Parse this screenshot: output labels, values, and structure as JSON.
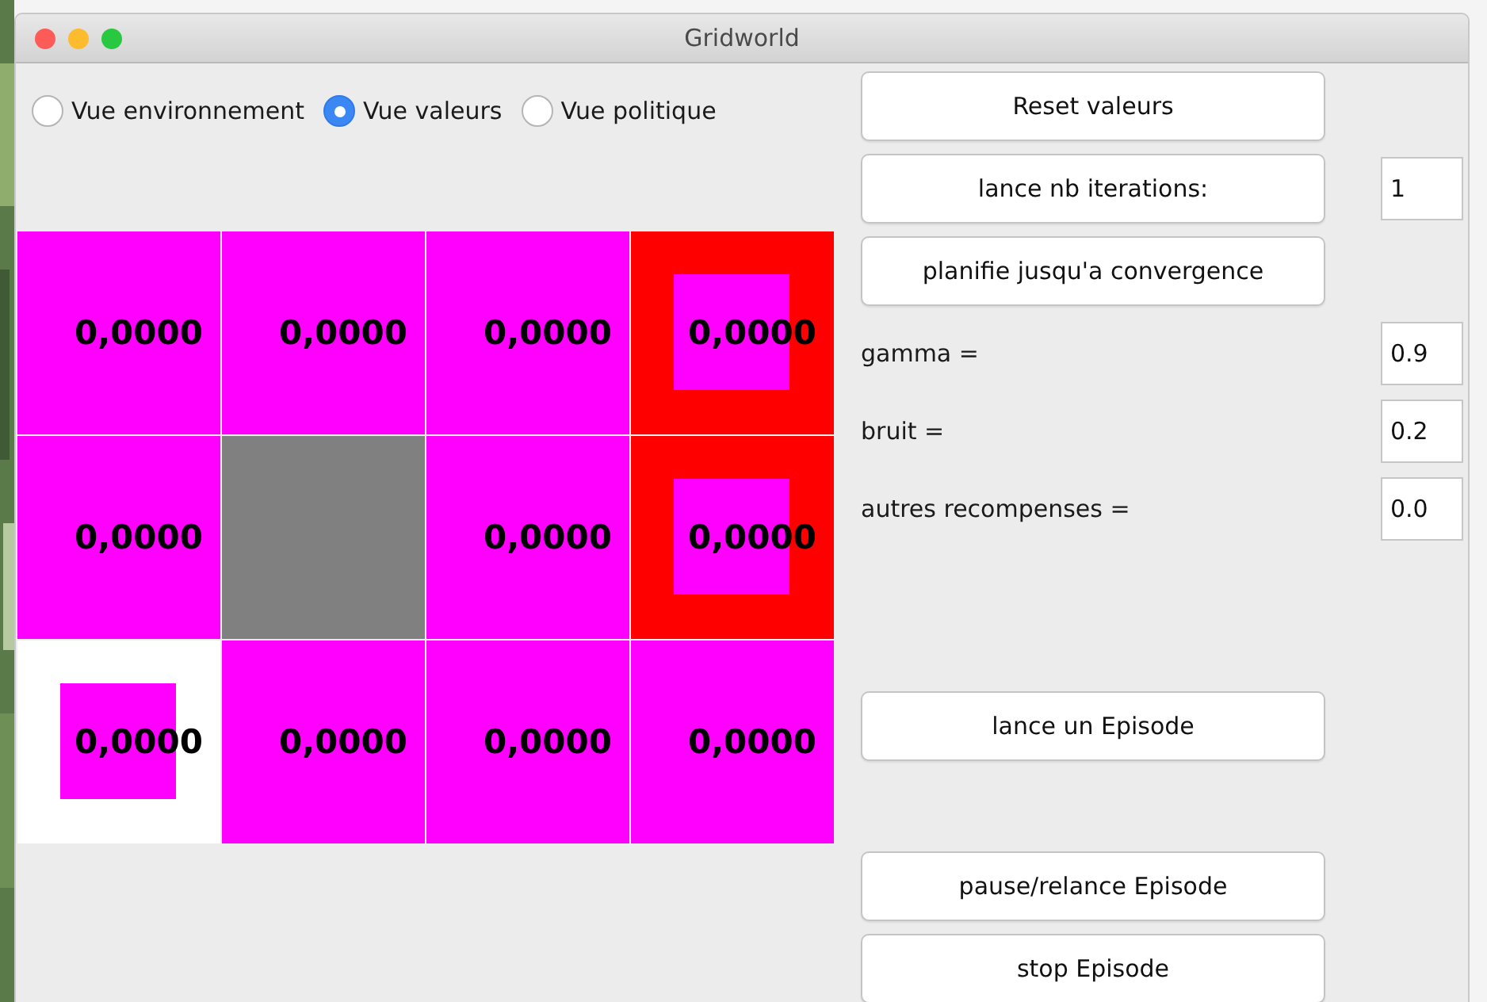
{
  "window": {
    "title": "Gridworld"
  },
  "view_options": [
    {
      "label": "Vue environnement",
      "selected": false
    },
    {
      "label": "Vue valeurs",
      "selected": true
    },
    {
      "label": "Vue politique",
      "selected": false
    }
  ],
  "grid": {
    "rows": [
      [
        {
          "kind": "normal",
          "value": "0,0000"
        },
        {
          "kind": "normal",
          "value": "0,0000"
        },
        {
          "kind": "normal",
          "value": "0,0000"
        },
        {
          "kind": "exit",
          "value": "0,0000"
        }
      ],
      [
        {
          "kind": "normal",
          "value": "0,0000"
        },
        {
          "kind": "wall"
        },
        {
          "kind": "normal",
          "value": "0,0000"
        },
        {
          "kind": "exit",
          "value": "0,0000"
        }
      ],
      [
        {
          "kind": "start",
          "value": "0,0000"
        },
        {
          "kind": "normal",
          "value": "0,0000"
        },
        {
          "kind": "normal",
          "value": "0,0000"
        },
        {
          "kind": "normal",
          "value": "0,0000"
        }
      ]
    ]
  },
  "controls": {
    "reset_button": "Reset valeurs",
    "iterations_button": "lance nb iterations:",
    "iterations_value": "1",
    "converge_button": "planifie jusqu'a convergence",
    "params": [
      {
        "label": "gamma =",
        "value": "0.9"
      },
      {
        "label": "bruit =",
        "value": "0.2"
      },
      {
        "label": "autres recompenses =",
        "value": "0.0"
      }
    ],
    "episode_button": "lance un Episode",
    "pause_button": "pause/relance Episode",
    "stop_button": "stop Episode"
  }
}
